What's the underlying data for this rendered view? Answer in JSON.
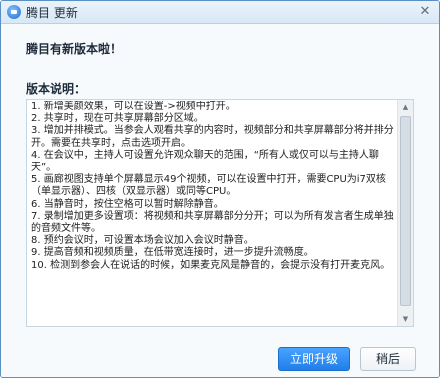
{
  "window": {
    "title": "腾目 更新",
    "close_symbol": "✕"
  },
  "headline": "腾目有新版本啦！",
  "notes": {
    "label": "版本说明：",
    "text": "1. 新增美颜效果，可以在设置->视频中打开。\n2. 共享时，现在可共享屏幕部分区域。\n3. 增加并排模式。当参会人观看共享的内容时，视频部分和共享屏幕部分将并排分开。需要在共享时，点击选项开启。\n4. 在会议中，主持人可设置允许观众聊天的范围，“所有人或仅可以与主持人聊天”。\n5. 画廊视图支持单个屏幕显示49个视频，可以在设置中打开，需要CPU为i7双核（单显示器）、四核（双显示器）或同等CPU。\n6. 当静音时，按住空格可以暂时解除静音。\n7. 录制增加更多设置项：将视频和共享屏幕部分分开；可以为所有发言者生成单独的音频文件等。\n8. 预约会议时，可设置本场会议加入会议时静音。\n9. 提高音频和视频质量，在低带宽连接时，进一步提升流畅度。\n10. 检测到参会人在说话的时候，如果麦克风是静音的，会提示没有打开麦克风。"
  },
  "buttons": {
    "upgrade": "立即升级",
    "later": "稍后"
  },
  "colors": {
    "accent": "#2f8ef4",
    "border": "#5a8fc4"
  }
}
